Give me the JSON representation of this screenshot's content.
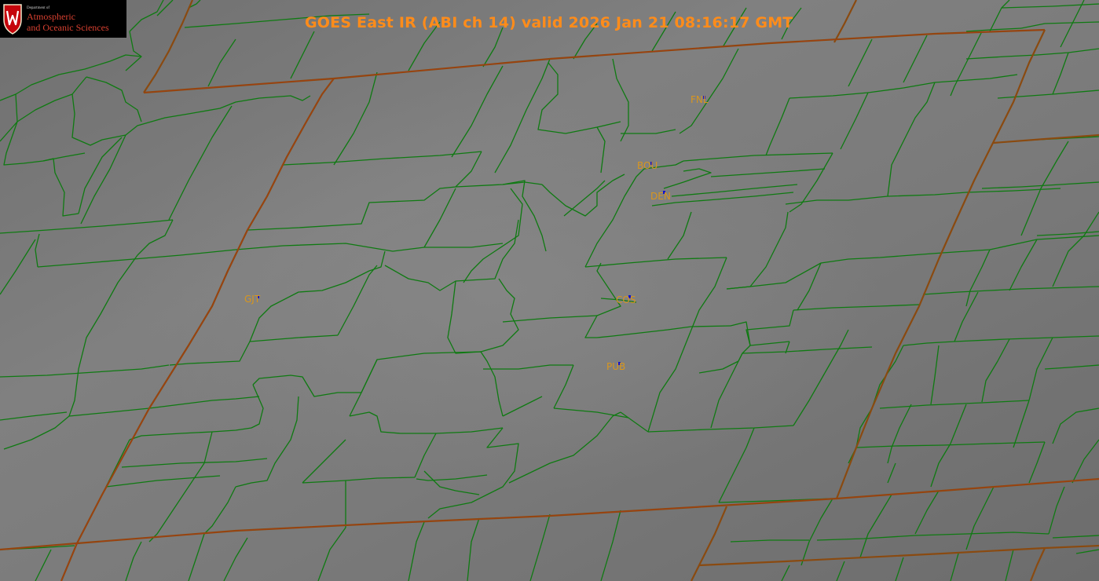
{
  "title": "GOES East IR (ABI ch 14) valid 2026 Jan 21 08:16:17 GMT",
  "logo": {
    "dept": "Department of",
    "line1": "Atmospheric",
    "line2": "and Oceanic Sciences"
  },
  "stations": [
    {
      "id": "FNL",
      "label": "FNL"
    },
    {
      "id": "BOU",
      "label": "BOU"
    },
    {
      "id": "DEN",
      "label": "DEN"
    },
    {
      "id": "GJT",
      "label": "GJT"
    },
    {
      "id": "COS",
      "label": "COS"
    },
    {
      "id": "PUB",
      "label": "PUB"
    }
  ],
  "colors": {
    "background": "#777777",
    "title": "#ff8c1a",
    "state_border": "#8a4a10",
    "county_border": "#0f7a12",
    "station_label": "#d8961e",
    "station_marker": "#1010d0",
    "logo_red": "#d84030"
  }
}
